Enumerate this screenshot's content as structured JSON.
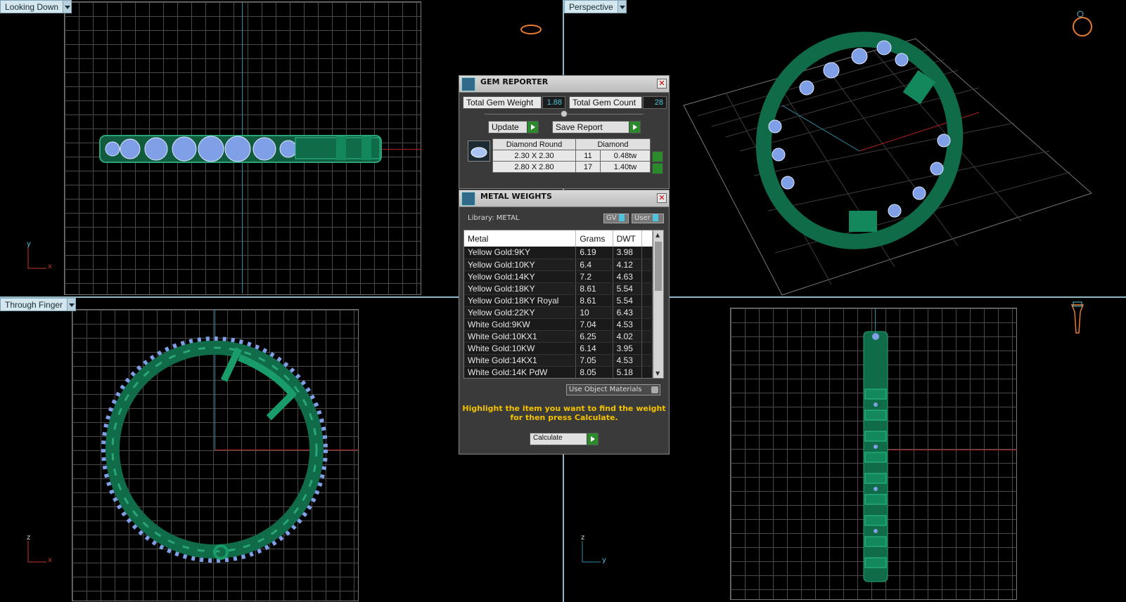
{
  "viewports": {
    "top_left": {
      "label": "Looking Down",
      "axes": {
        "vertical": "y",
        "horizontal": "x"
      }
    },
    "top_right": {
      "label": "Perspective"
    },
    "bottom_left": {
      "label": "Through Finger",
      "axes": {
        "vertical": "z",
        "horizontal": "x"
      }
    },
    "bottom_right": {
      "axes": {
        "vertical": "z",
        "horizontal": "y"
      }
    }
  },
  "gem_reporter": {
    "title": "GEM REPORTER",
    "close": "✕",
    "total_weight_label": "Total Gem Weight",
    "total_weight_value": "1.88",
    "total_count_label": "Total Gem Count",
    "total_count_value": "28",
    "update_label": "Update",
    "save_report_label": "Save Report",
    "table": {
      "col1": "Diamond Round",
      "col2": "Diamond",
      "rows": [
        {
          "size": "2.30 X 2.30",
          "count": "11",
          "weight": "0.48tw"
        },
        {
          "size": "2.80 X 2.80",
          "count": "17",
          "weight": "1.40tw"
        }
      ]
    }
  },
  "metal_weights": {
    "title": "METAL WEIGHTS",
    "close": "✕",
    "library_label": "Library: METAL",
    "toggle_gv": "GV",
    "toggle_user": "User",
    "columns": [
      "Metal",
      "Grams",
      "DWT"
    ],
    "rows": [
      [
        "Yellow Gold:9KY",
        "6.19",
        "3.98"
      ],
      [
        "Yellow Gold:10KY",
        "6.4",
        "4.12"
      ],
      [
        "Yellow Gold:14KY",
        "7.2",
        "4.63"
      ],
      [
        "Yellow Gold:18KY",
        "8.61",
        "5.54"
      ],
      [
        "Yellow Gold:18KY Royal",
        "8.61",
        "5.54"
      ],
      [
        "Yellow Gold:22KY",
        "10",
        "6.43"
      ],
      [
        "White Gold:9KW",
        "7.04",
        "4.53"
      ],
      [
        "White Gold:10KX1",
        "6.25",
        "4.02"
      ],
      [
        "White Gold:10KW",
        "6.14",
        "3.95"
      ],
      [
        "White Gold:14KX1",
        "7.05",
        "4.53"
      ],
      [
        "White Gold:14K PdW",
        "8.05",
        "5.18"
      ]
    ],
    "use_object_materials_label": "Use Object Materials",
    "hint_line1": "Highlight the item you want to find the weight",
    "hint_line2": "for then press Calculate.",
    "calculate_label": "Calculate"
  }
}
